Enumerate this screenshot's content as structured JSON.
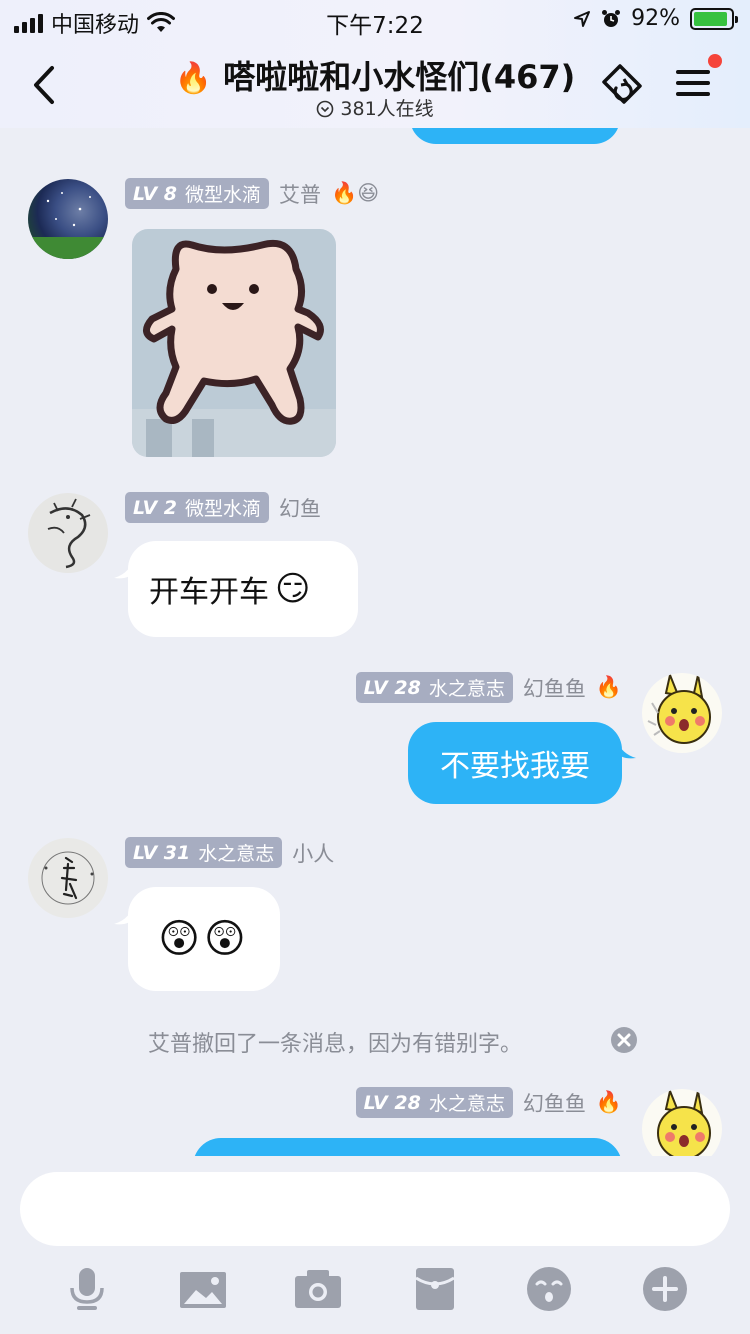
{
  "status_bar": {
    "carrier": "中国移动",
    "time": "下午7:22",
    "battery": "92%",
    "battery_level": 0.92
  },
  "header": {
    "title": "嗒啦啦和小水怪们(467)",
    "online": "381人在线",
    "fire_emoji": "🔥"
  },
  "messages": [
    {
      "sender": "艾普",
      "level": "LV 8",
      "rank": "微型水滴",
      "badges": "🔥😆",
      "type": "image"
    },
    {
      "sender": "幻鱼",
      "level": "LV 2",
      "rank": "微型水滴",
      "text": "开车开车",
      "emoji": "😏"
    },
    {
      "sender": "幻鱼鱼",
      "level": "LV 28",
      "rank": "水之意志",
      "badges": "🔥",
      "text": "不要找我要"
    },
    {
      "sender": "小人",
      "level": "LV 31",
      "rank": "水之意志",
      "emoji": "😲😲"
    },
    {
      "sender": "幻鱼鱼",
      "level": "LV 28",
      "rank": "水之意志",
      "badges": "🔥"
    }
  ],
  "notice": "艾普撤回了一条消息，因为有错别字。",
  "input": {
    "placeholder": ""
  },
  "toolbar": [
    "microphone-icon",
    "image-icon",
    "camera-icon",
    "red-packet-icon",
    "emoji-icon",
    "plus-icon"
  ],
  "colors": {
    "accent": "#2db3f6",
    "background": "#eceef5",
    "tag": "#a7adc1",
    "notification": "#f5443a"
  }
}
